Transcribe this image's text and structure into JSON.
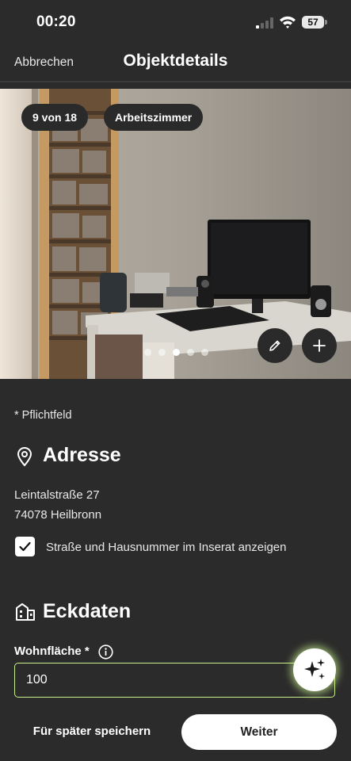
{
  "status_bar": {
    "time": "00:20",
    "battery": "57"
  },
  "header": {
    "cancel_label": "Abbrechen",
    "title": "Objektdetails"
  },
  "gallery": {
    "counter": "9 von 18",
    "room_label": "Arbeitszimmer",
    "dot_count": 5,
    "active_dot": 3
  },
  "form": {
    "required_note": "* Pflichtfeld",
    "address_section": {
      "title": "Adresse",
      "street": "Leintalstraße 27",
      "city": "74078 Heilbronn",
      "show_address_checkbox": {
        "label": "Straße und Hausnummer im Inserat anzeigen",
        "checked": true
      }
    },
    "key_data_section": {
      "title": "Eckdaten",
      "living_area": {
        "label": "Wohnfläche *",
        "value": "100"
      }
    }
  },
  "footer": {
    "save_later_label": "Für später speichern",
    "next_label": "Weiter"
  },
  "colors": {
    "background": "#2b2b2b",
    "accent_border": "#c9f08a",
    "primary_button": "#ffffff"
  }
}
